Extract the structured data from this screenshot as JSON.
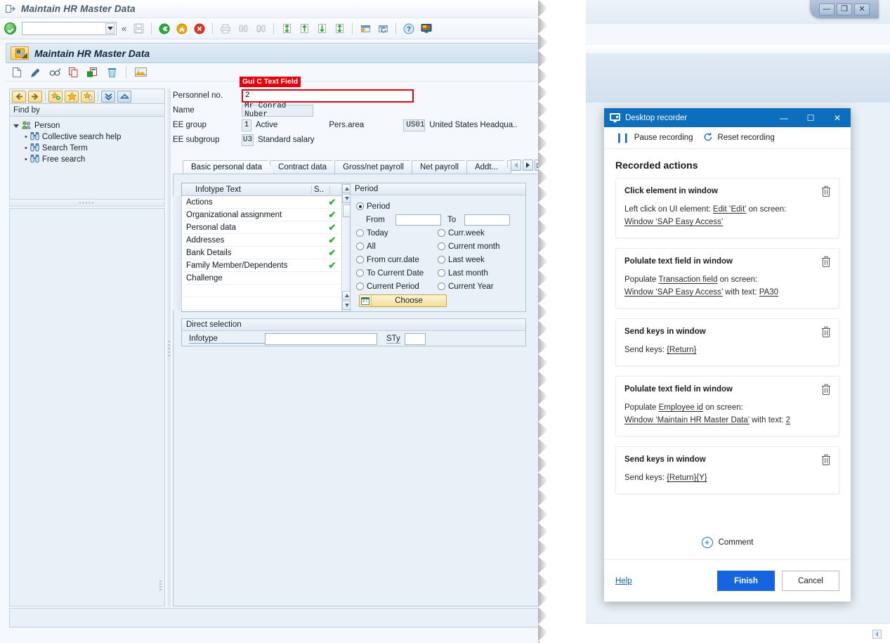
{
  "sap": {
    "window_title": "Maintain HR Master Data",
    "app_title": "Maintain HR Master Data",
    "command_field_value": "",
    "toolbar_icons": [
      "confirm-icon",
      "command-field",
      "menu-chevron-icon",
      "save-icon",
      "back-icon",
      "exit-icon",
      "cancel-icon",
      "print-icon",
      "find-icon",
      "find-next-icon",
      "first-page-icon",
      "previous-page-icon",
      "next-page-icon",
      "last-page-icon",
      "create-session-icon",
      "create-shortcut-icon",
      "help-icon",
      "customize-icon"
    ],
    "app_toolbar_icons": [
      "create-icon",
      "change-icon",
      "display-icon",
      "copy-icon",
      "delimit-icon",
      "delete-icon",
      "overview-icon"
    ],
    "tree": {
      "nav_buttons": [
        "back-icon",
        "forward-icon",
        "add-favorite-icon",
        "favorite-icon",
        "delete-favorite-icon",
        "expand-all-icon",
        "collapse-all-icon"
      ],
      "header": "Find by",
      "root": "Person",
      "items": [
        {
          "label": "Collective search help",
          "icon": "binoculars-icon"
        },
        {
          "label": "Search Term",
          "icon": "binoculars-icon"
        },
        {
          "label": "Free search",
          "icon": "binoculars-icon"
        }
      ]
    },
    "form": {
      "tooltip": "Gui C Text Field",
      "personnel_no_label": "Personnel no.",
      "personnel_no_value": "2",
      "name_label": "Name",
      "name_value": "Mr Conrad Nuber",
      "ee_group_label": "EE group",
      "ee_group_code": "1",
      "ee_group_text": "Active",
      "pers_area_label": "Pers.area",
      "pers_area_code": "US01",
      "pers_area_text": "United States Headqua..",
      "ee_subgroup_label": "EE subgroup",
      "ee_subgroup_code": "U3",
      "ee_subgroup_text": "Standard salary"
    },
    "tabs": [
      {
        "label": "Basic personal data",
        "active": true
      },
      {
        "label": "Contract data",
        "active": false
      },
      {
        "label": "Gross/net payroll",
        "active": false
      },
      {
        "label": "Net payroll",
        "active": false
      },
      {
        "label": "Addt...",
        "active": false
      }
    ],
    "infotype_grid": {
      "col_text": "Infotype Text",
      "col_status": "S..",
      "rows": [
        {
          "text": "Actions",
          "selected": true
        },
        {
          "text": "Organizational assignment",
          "selected": true
        },
        {
          "text": "Personal data",
          "selected": true
        },
        {
          "text": "Addresses",
          "selected": true
        },
        {
          "text": "Bank Details",
          "selected": true
        },
        {
          "text": "Family Member/Dependents",
          "selected": true
        },
        {
          "text": "Challenge",
          "selected": false
        },
        {
          "text": "",
          "selected": false
        },
        {
          "text": "",
          "selected": false
        }
      ]
    },
    "period": {
      "title": "Period",
      "from_label": "From",
      "from_value": "",
      "to_label": "To",
      "to_value": "",
      "options_left": [
        {
          "label": "Period",
          "checked": true
        },
        {
          "label": "Today",
          "checked": false
        },
        {
          "label": "All",
          "checked": false
        },
        {
          "label": "From curr.date",
          "checked": false
        },
        {
          "label": "To Current Date",
          "checked": false
        },
        {
          "label": "Current Period",
          "checked": false
        }
      ],
      "options_right": [
        {
          "label": "Curr.week",
          "checked": false
        },
        {
          "label": "Current month",
          "checked": false
        },
        {
          "label": "Last week",
          "checked": false
        },
        {
          "label": "Last month",
          "checked": false
        },
        {
          "label": "Current Year",
          "checked": false
        }
      ],
      "choose_button": "Choose"
    },
    "direct_selection": {
      "title": "Direct selection",
      "infotype_label": "Infotype",
      "infotype_value": "",
      "sty_label": "STy",
      "sty_value": ""
    }
  },
  "window_controls": {
    "minimize": "—",
    "restore": "❐",
    "close": "✕"
  },
  "recorder": {
    "title": "Desktop recorder",
    "minimize_label": "—",
    "maximize_label": "☐",
    "close_label": "✕",
    "pause_label": "Pause recording",
    "reset_label": "Reset recording",
    "section_heading": "Recorded actions",
    "actions": [
      {
        "title": "Click element in window",
        "lines": [
          [
            {
              "t": "Left click on UI element: ",
              "u": false
            },
            {
              "t": "Edit ‘Edit’",
              "u": true
            },
            {
              "t": " on screen:",
              "u": false
            }
          ],
          [
            {
              "t": "Window ‘SAP Easy Access’",
              "u": true
            }
          ]
        ]
      },
      {
        "title": "Polulate text field in window",
        "lines": [
          [
            {
              "t": "Populate ",
              "u": false
            },
            {
              "t": "Transaction field",
              "u": true
            },
            {
              "t": " on screen:",
              "u": false
            }
          ],
          [
            {
              "t": "Window ‘SAP Easy Access’",
              "u": true
            },
            {
              "t": " with text: ",
              "u": false
            },
            {
              "t": "PA30",
              "u": true
            }
          ]
        ]
      },
      {
        "title": "Send keys in window",
        "lines": [
          [
            {
              "t": "Send keys: ",
              "u": false
            },
            {
              "t": "{Return}",
              "u": true
            }
          ]
        ]
      },
      {
        "title": "Polulate text field in window",
        "lines": [
          [
            {
              "t": "Populate ",
              "u": false
            },
            {
              "t": "Employee id",
              "u": true
            },
            {
              "t": " on screen:",
              "u": false
            }
          ],
          [
            {
              "t": "Window ‘Maintain HR Master Data’",
              "u": true
            },
            {
              "t": " with text: ",
              "u": false
            },
            {
              "t": "2",
              "u": true
            }
          ]
        ]
      },
      {
        "title": "Send keys in window",
        "lines": [
          [
            {
              "t": "Send keys: ",
              "u": false
            },
            {
              "t": "{Return}{Y}",
              "u": true
            }
          ]
        ]
      }
    ],
    "comment_label": "Comment",
    "help_label": "Help",
    "finish_label": "Finish",
    "cancel_label": "Cancel"
  },
  "colors": {
    "sap_accent": "#0d6ebd",
    "highlight_red": "#e8000d",
    "primary_button": "#1565e0",
    "check_green": "#36a93c"
  }
}
